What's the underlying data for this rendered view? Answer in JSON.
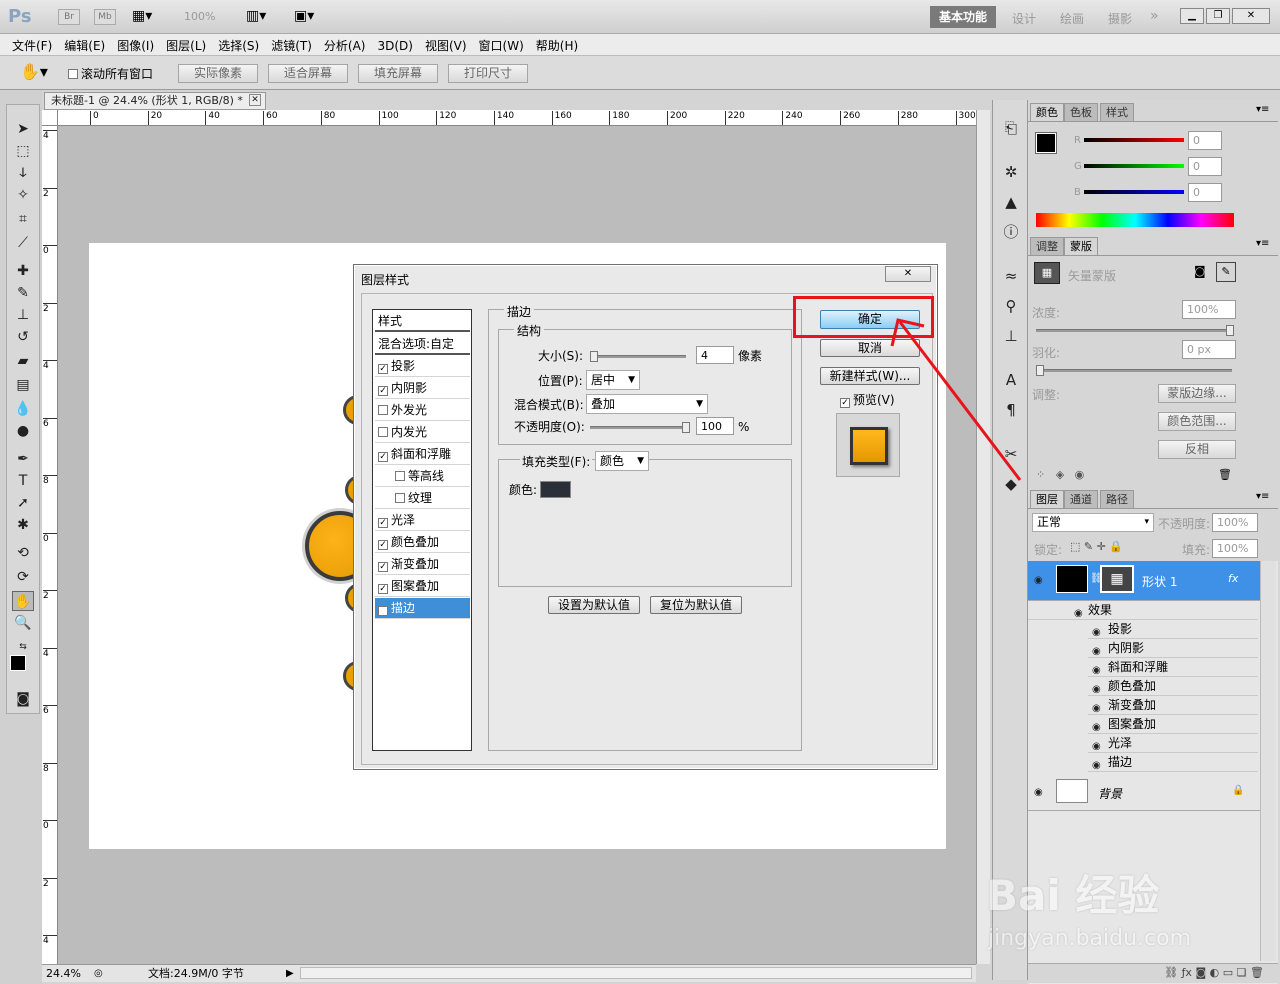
{
  "appbar": {
    "logo": "Ps",
    "icons": [
      "Br",
      "Mb"
    ],
    "zoom": "100%",
    "workspaces": [
      "基本功能",
      "设计",
      "绘画",
      "摄影"
    ],
    "more": "»"
  },
  "menu": [
    "文件(F)",
    "编辑(E)",
    "图像(I)",
    "图层(L)",
    "选择(S)",
    "滤镜(T)",
    "分析(A)",
    "3D(D)",
    "视图(V)",
    "窗口(W)",
    "帮助(H)"
  ],
  "options": {
    "scroll_all": "滚动所有窗口",
    "buttons": [
      "实际像素",
      "适合屏幕",
      "填充屏幕",
      "打印尺寸"
    ]
  },
  "document": {
    "tab_title": "未标题-1 @ 24.4% (形状 1, RGB/8) *",
    "ruler_h": [
      "0",
      "20",
      "40",
      "60",
      "80",
      "100",
      "120",
      "140",
      "160",
      "180",
      "200",
      "220",
      "240",
      "260",
      "280",
      "300"
    ],
    "ruler_v": [
      "4",
      "2",
      "0",
      "2",
      "4",
      "6",
      "8",
      "0",
      "2",
      "4",
      "6",
      "8",
      "0",
      "2",
      "4"
    ],
    "zoom": "24.4%",
    "doc_info": "文档:24.9M/0 字节"
  },
  "dialog": {
    "title": "图层样式",
    "styles_header": "样式",
    "blend_options": "混合选项:自定",
    "styles": [
      {
        "label": "投影",
        "checked": true
      },
      {
        "label": "内阴影",
        "checked": true
      },
      {
        "label": "外发光",
        "checked": false
      },
      {
        "label": "内发光",
        "checked": false
      },
      {
        "label": "斜面和浮雕",
        "checked": true
      },
      {
        "label": "等高线",
        "checked": false
      },
      {
        "label": "纹理",
        "checked": false
      },
      {
        "label": "光泽",
        "checked": true
      },
      {
        "label": "颜色叠加",
        "checked": true
      },
      {
        "label": "渐变叠加",
        "checked": true
      },
      {
        "label": "图案叠加",
        "checked": true
      },
      {
        "label": "描边",
        "checked": true
      }
    ],
    "stroke_group": "描边",
    "structure_group": "结构",
    "size_label": "大小(S):",
    "size_value": "4",
    "size_unit": "像素",
    "position_label": "位置(P):",
    "position_value": "居中",
    "blend_label": "混合模式(B):",
    "blend_value": "叠加",
    "opacity_label": "不透明度(O):",
    "opacity_value": "100",
    "opacity_unit": "%",
    "fill_type_label": "填充类型(F):",
    "fill_type_value": "颜色",
    "color_label": "颜色:",
    "stroke_color": "#2b2f38",
    "set_default": "设置为默认值",
    "reset_default": "复位为默认值",
    "ok": "确定",
    "cancel": "取消",
    "new_style": "新建样式(W)...",
    "preview": "预览(V)",
    "preview_checked": true
  },
  "color_panel": {
    "tabs": [
      "颜色",
      "色板",
      "样式"
    ],
    "channels": [
      {
        "label": "R",
        "value": "0"
      },
      {
        "label": "G",
        "value": "0"
      },
      {
        "label": "B",
        "value": "0"
      }
    ]
  },
  "mask_panel": {
    "tabs": [
      "调整",
      "蒙版"
    ],
    "vector_mask": "矢量蒙版",
    "density_label": "浓度:",
    "density_value": "100%",
    "feather_label": "羽化:",
    "feather_value": "0 px",
    "adjust_label": "调整:",
    "buttons": [
      "蒙版边缘...",
      "颜色范围...",
      "反相"
    ]
  },
  "layers_panel": {
    "tabs": [
      "图层",
      "通道",
      "路径"
    ],
    "blend_mode": "正常",
    "opacity_label": "不透明度:",
    "opacity_value": "100%",
    "lock_label": "锁定:",
    "fill_label": "填充:",
    "fill_value": "100%",
    "layer1_name": "形状 1",
    "fx": "fx",
    "effects_label": "效果",
    "effects": [
      "投影",
      "内阴影",
      "斜面和浮雕",
      "颜色叠加",
      "渐变叠加",
      "图案叠加",
      "光泽",
      "描边"
    ],
    "bg_name": "背景"
  },
  "watermark": {
    "brand": "Bai 经验",
    "url": "jingyan.baidu.com"
  },
  "annotation_color": "#e8141c"
}
